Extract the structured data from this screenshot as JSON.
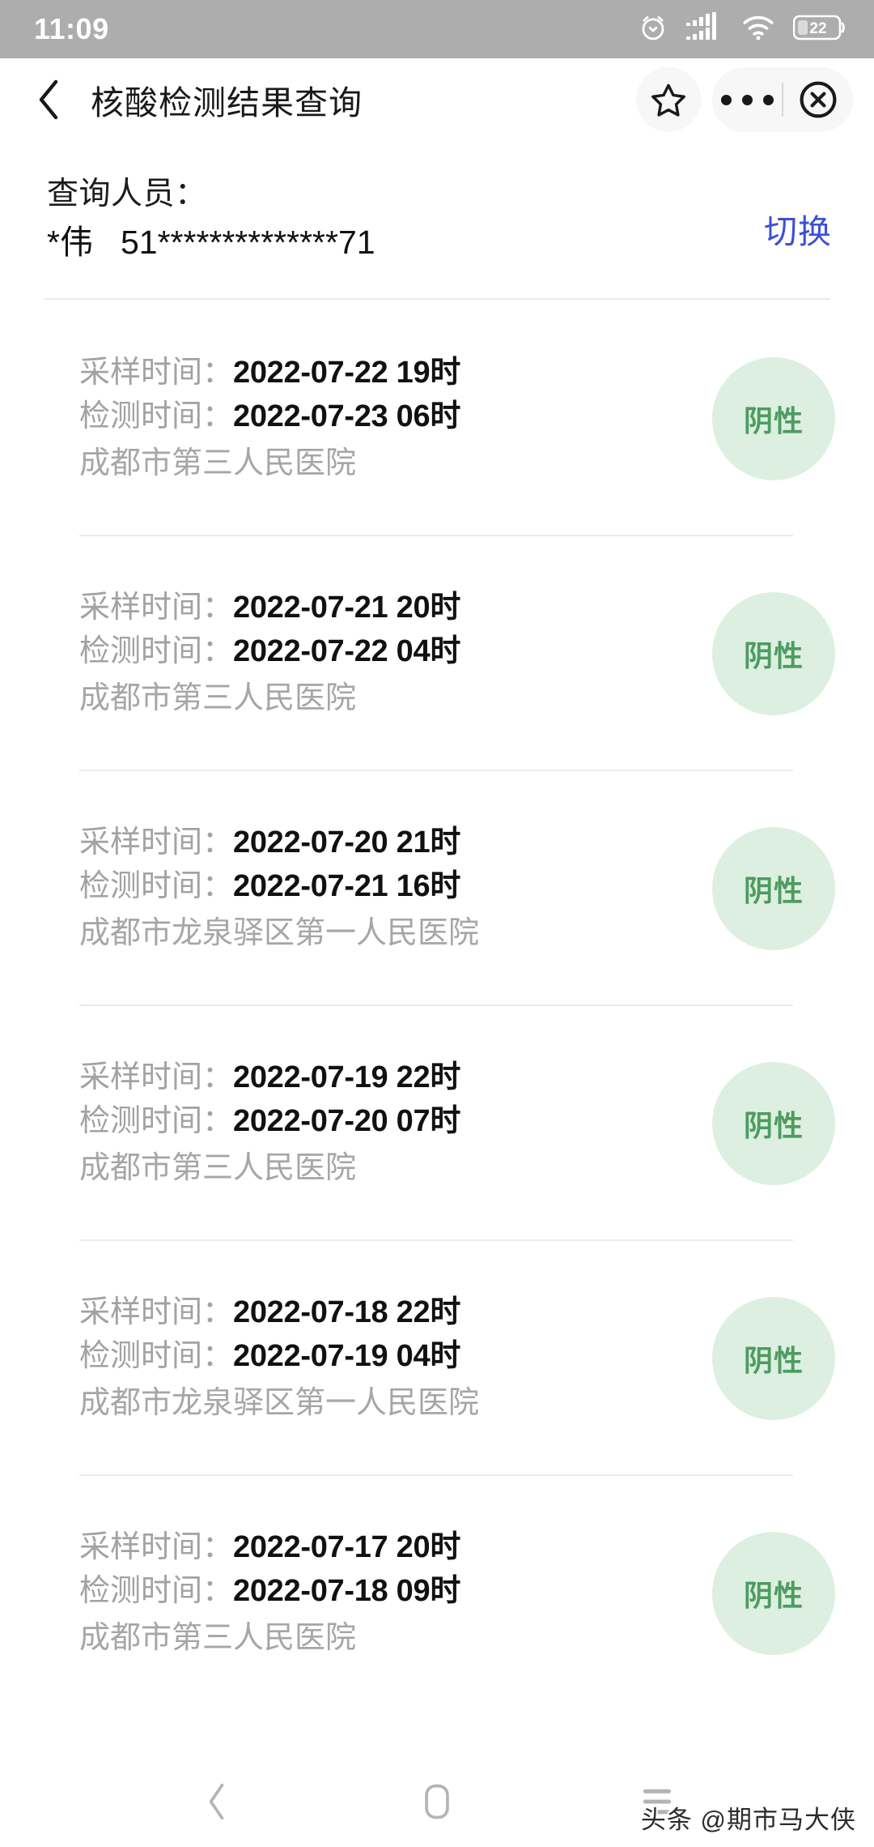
{
  "status_bar": {
    "time": "11:09",
    "battery_percent": "22",
    "icons": [
      "alarm-clock-icon",
      "signal-bars-icon",
      "wifi-icon",
      "battery-icon"
    ]
  },
  "header": {
    "back_label": "‹",
    "title": "核酸检测结果查询",
    "favorite_icon": "star-icon",
    "more_icon": "more-dots-icon",
    "close_icon": "close-circle-icon"
  },
  "person": {
    "label": "查询人员：",
    "name": "*伟",
    "id_number": "51**************71",
    "switch_label": "切换"
  },
  "labels": {
    "sample_time": "采样时间：",
    "test_time": "检测时间："
  },
  "colors": {
    "status_bar_bg": "#adadad",
    "switch_link": "#3b4fd8",
    "badge_bg": "#ddefe0",
    "badge_text": "#4d9c60",
    "value_text": "#111111",
    "muted_text": "#a2a2a2"
  },
  "results": [
    {
      "sample_time": "2022-07-22 19时",
      "test_time": "2022-07-23 06时",
      "hospital": "成都市第三人民医院",
      "result": "阴性"
    },
    {
      "sample_time": "2022-07-21 20时",
      "test_time": "2022-07-22 04时",
      "hospital": "成都市第三人民医院",
      "result": "阴性"
    },
    {
      "sample_time": "2022-07-20 21时",
      "test_time": "2022-07-21 16时",
      "hospital": "成都市龙泉驿区第一人民医院",
      "result": "阴性"
    },
    {
      "sample_time": "2022-07-19 22时",
      "test_time": "2022-07-20 07时",
      "hospital": "成都市第三人民医院",
      "result": "阴性"
    },
    {
      "sample_time": "2022-07-18 22时",
      "test_time": "2022-07-19 04时",
      "hospital": "成都市龙泉驿区第一人民医院",
      "result": "阴性"
    },
    {
      "sample_time": "2022-07-17 20时",
      "test_time": "2022-07-18 09时",
      "hospital": "成都市第三人民医院",
      "result": "阴性"
    }
  ],
  "nav_bar": {
    "back_icon": "chevron-left-icon",
    "home_icon": "home-square-icon",
    "recents_icon": "menu-lines-icon"
  },
  "watermark": {
    "text": "头条 @期市马大侠"
  }
}
